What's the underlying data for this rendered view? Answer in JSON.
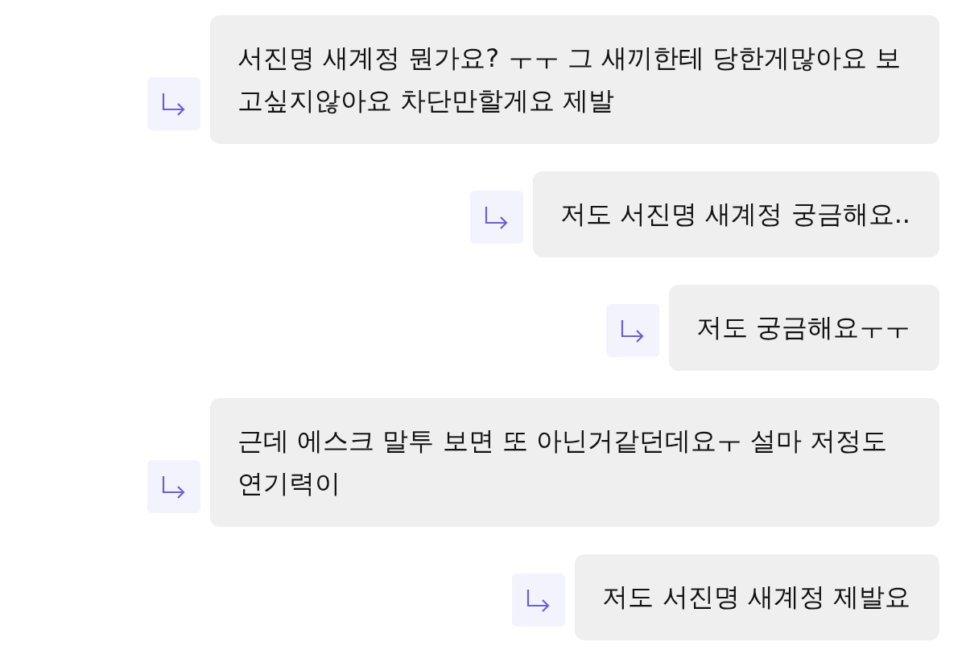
{
  "replies": [
    {
      "text": "서진명 새계정 뭔가요? ㅜㅜ 그 새끼한테 당한게많아요 보고싶지않아요 차단만할게요 제발"
    },
    {
      "text": "저도 서진명 새계정 궁금해요.."
    },
    {
      "text": "저도 궁금해요ㅜㅜ"
    },
    {
      "text": "근데 에스크 말투 보면 또 아닌거같던데요ㅜ 설마 저정도 연기력이"
    },
    {
      "text": "저도 서진명 새계정 제발요"
    }
  ]
}
